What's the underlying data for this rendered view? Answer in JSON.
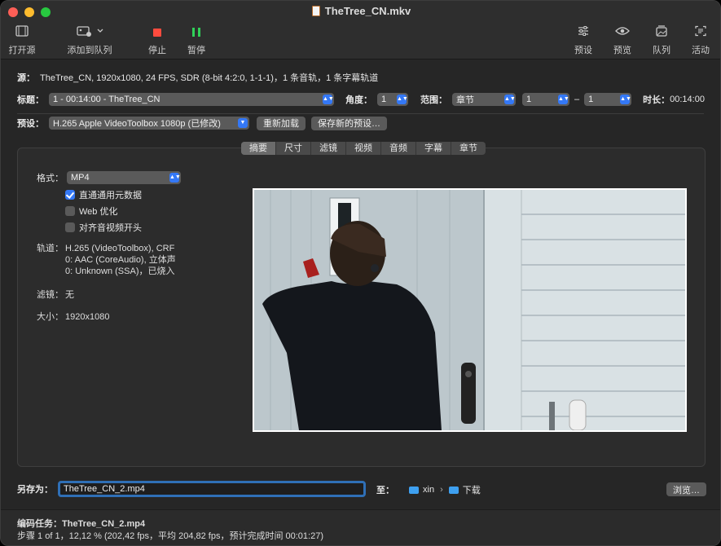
{
  "window": {
    "title": "TheTree_CN.mkv"
  },
  "toolbar": {
    "open_source": "打开源",
    "add_queue": "添加到队列",
    "stop": "停止",
    "pause": "暂停",
    "presets": "预设",
    "preview": "预览",
    "queue": "队列",
    "activity": "活动",
    "colors": {
      "stop": "#ff4b3e",
      "pause": "#30d158"
    }
  },
  "source": {
    "label": "源：",
    "value": "TheTree_CN, 1920x1080, 24 FPS, SDR (8-bit 4:2:0, 1-1-1)，1 条音轨，1 条字幕轨道"
  },
  "title_row": {
    "title_label": "标题：",
    "title_value": "1 - 00:14:00 - TheTree_CN",
    "angle_label": "角度：",
    "angle_value": "1",
    "range_label": "范围：",
    "range_type": "章节",
    "range_start": "1",
    "range_dash": "–",
    "range_end": "1",
    "duration_label": "时长：",
    "duration_value": "00:14:00"
  },
  "preset_row": {
    "label": "预设：",
    "value": "H.265 Apple VideoToolbox 1080p (已修改)",
    "reload": "重新加载",
    "save_new": "保存新的预设…"
  },
  "tabs": [
    "摘要",
    "尺寸",
    "滤镜",
    "视频",
    "音频",
    "字幕",
    "章节"
  ],
  "summary": {
    "format_label": "格式：",
    "format_value": "MP4",
    "passthru_metadata": "直通通用元数据",
    "passthru_checked": true,
    "web_optimized": "Web 优化",
    "web_checked": false,
    "align_av": "对齐音视频开头",
    "align_checked": false,
    "tracks_label": "轨道：",
    "tracks": [
      "H.265 (VideoToolbox), CRF",
      "0: AAC (CoreAudio), 立体声",
      "0: Unknown (SSA)，已烧入"
    ],
    "filters_label": "滤镜：",
    "filters_value": "无",
    "size_label": "大小：",
    "size_value": "1920x1080"
  },
  "save": {
    "label": "另存为：",
    "filename": "TheTree_CN_2.mp4",
    "to_label": "至：",
    "path": [
      "xin",
      "下载"
    ],
    "path_sep": "›",
    "browse": "浏览…"
  },
  "status": {
    "job": "编码任务：TheTree_CN_2.mp4",
    "progress": "步骤 1 of 1，12,12 % (202,42 fps，平均 204,82 fps，预计完成时间 00:01:27)"
  },
  "colors": {
    "accent": "#3478f6",
    "window_bg": "#262626"
  }
}
